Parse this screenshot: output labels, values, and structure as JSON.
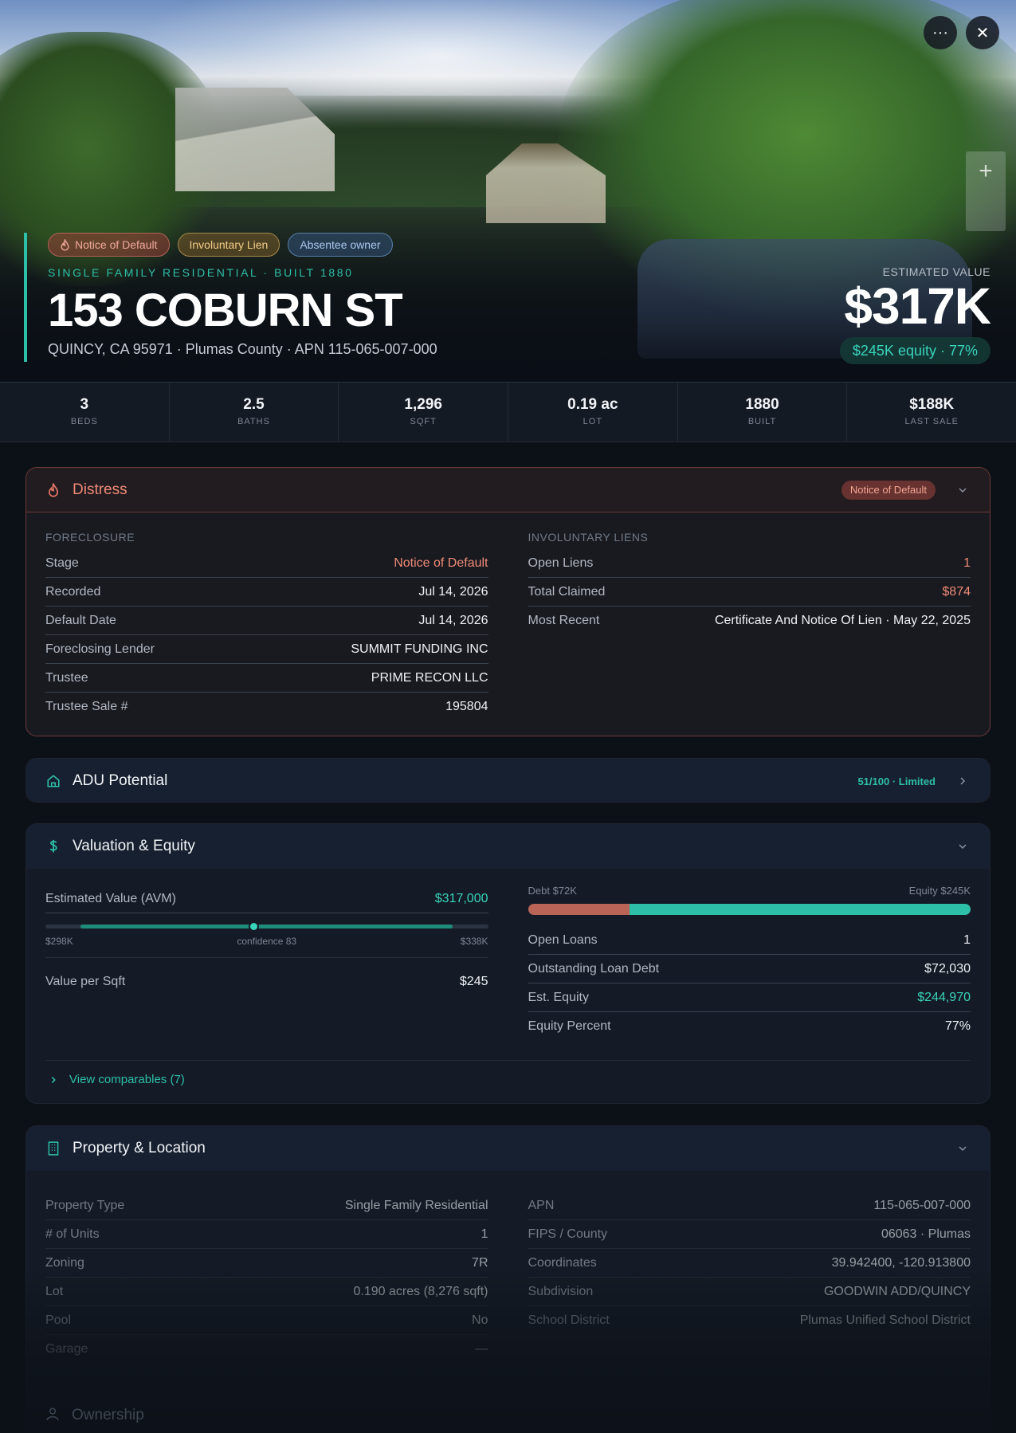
{
  "hero": {
    "badges": [
      {
        "label": "Notice of Default",
        "icon": "flame-icon"
      },
      {
        "label": "Involuntary Lien"
      },
      {
        "label": "Absentee owner"
      }
    ],
    "subtitle": "SINGLE FAMILY RESIDENTIAL · BUILT 1880",
    "title": "153 COBURN ST",
    "address": "QUINCY, CA 95971 · Plumas County · APN 115-065-007-000",
    "estimated_label": "ESTIMATED VALUE",
    "estimated_value": "$317K",
    "equity_pill": "$245K equity · 77%",
    "more_icon": "···",
    "close_icon": "✕",
    "zoom_plus": "+"
  },
  "stats": [
    {
      "value": "3",
      "label": "BEDS"
    },
    {
      "value": "2.5",
      "label": "BATHS"
    },
    {
      "value": "1,296",
      "label": "SQFT"
    },
    {
      "value": "0.19 ac",
      "label": "LOT"
    },
    {
      "value": "1880",
      "label": "BUILT"
    },
    {
      "value": "$188K",
      "label": "LAST SALE"
    }
  ],
  "distress": {
    "title": "Distress",
    "chip": "Notice of Default",
    "foreclosure_label": "FORECLOSURE",
    "foreclosure": [
      {
        "k": "Stage",
        "v": "Notice of Default"
      },
      {
        "k": "Recorded",
        "v": "Jul 14, 2026"
      },
      {
        "k": "Default Date",
        "v": "Jul 14, 2026"
      },
      {
        "k": "Foreclosing Lender",
        "v": "SUMMIT FUNDING INC"
      },
      {
        "k": "Trustee",
        "v": "PRIME RECON LLC"
      },
      {
        "k": "Trustee Sale #",
        "v": "195804"
      }
    ],
    "liens_label": "INVOLUNTARY LIENS",
    "liens": [
      {
        "k": "Open Liens",
        "v": "1"
      },
      {
        "k": "Total Claimed",
        "v": "$874"
      },
      {
        "k": "Most Recent",
        "v": "Certificate And Notice Of Lien · May 22, 2025"
      }
    ]
  },
  "adu": {
    "title": "ADU Potential",
    "score": "51/100 · Limited"
  },
  "valuation": {
    "title": "Valuation & Equity",
    "avm_label": "Estimated Value (AVM)",
    "avm_value": "$317,000",
    "range_low": "$298K",
    "range_high": "$338K",
    "confidence": "confidence 83",
    "value_per_sqft_label": "Value per Sqft",
    "value_per_sqft": "$245",
    "debt_label": "Debt $72K",
    "equity_label": "Equity $245K",
    "debt_fraction": 0.23,
    "avm_fraction": 0.47,
    "range_start_fraction": 0.08,
    "range_end_fraction": 0.92,
    "loans": [
      {
        "k": "Open Loans",
        "v": "1"
      },
      {
        "k": "Outstanding Loan Debt",
        "v": "$72,030"
      },
      {
        "k": "Est. Equity",
        "v": "$244,970"
      },
      {
        "k": "Equity Percent",
        "v": "77%"
      }
    ],
    "comps_label": "View comparables (7)"
  },
  "property": {
    "title": "Property & Location",
    "left": [
      {
        "k": "Property Type",
        "v": "Single Family Residential"
      },
      {
        "k": "# of Units",
        "v": "1"
      },
      {
        "k": "Zoning",
        "v": "7R"
      },
      {
        "k": "Lot",
        "v": "0.190 acres (8,276 sqft)"
      },
      {
        "k": "Pool",
        "v": "No"
      },
      {
        "k": "Garage",
        "v": "—"
      }
    ],
    "right": [
      {
        "k": "APN",
        "v": "115-065-007-000"
      },
      {
        "k": "FIPS / County",
        "v": "06063 · Plumas"
      },
      {
        "k": "Coordinates",
        "v": "39.942400, -120.913800"
      },
      {
        "k": "Subdivision",
        "v": "GOODWIN ADD/QUINCY"
      },
      {
        "k": "School District",
        "v": "Plumas Unified School District"
      }
    ]
  },
  "ownership": {
    "title": "Ownership"
  },
  "colors": {
    "accent": "#2dbfa8",
    "distress": "#ef8a76",
    "debt": "#b96456"
  }
}
